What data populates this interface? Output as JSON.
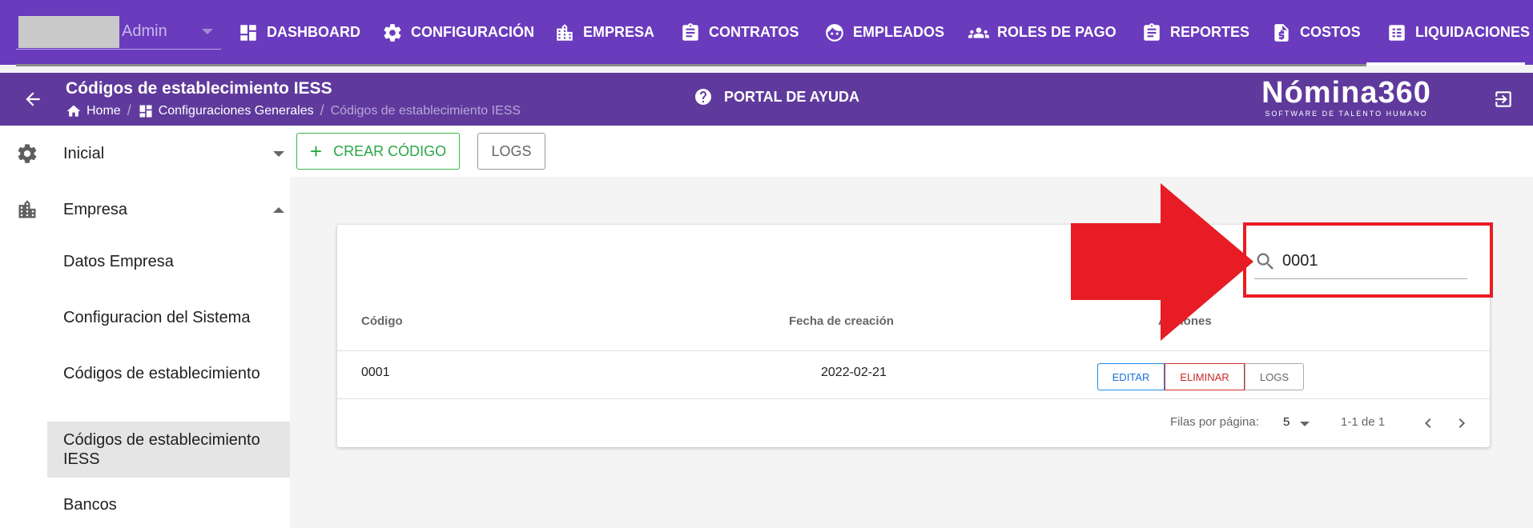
{
  "topbar": {
    "user_name": "Admin",
    "nav": [
      {
        "label": "DASHBOARD",
        "icon": "dashboard-icon"
      },
      {
        "label": "CONFIGURACIÓN",
        "icon": "gear-icon"
      },
      {
        "label": "EMPRESA",
        "icon": "building-icon"
      },
      {
        "label": "CONTRATOS",
        "icon": "clipboard-icon"
      },
      {
        "label": "EMPLEADOS",
        "icon": "face-icon"
      },
      {
        "label": "ROLES DE PAGO",
        "icon": "group-icon"
      },
      {
        "label": "REPORTES",
        "icon": "clipboard-icon"
      },
      {
        "label": "COSTOS",
        "icon": "invoice-icon"
      },
      {
        "label": "LIQUIDACIONES",
        "icon": "list-icon"
      }
    ]
  },
  "subheader": {
    "title": "Códigos de establecimiento IESS",
    "breadcrumb": {
      "home": "Home",
      "section": "Configuraciones Generales",
      "current": "Códigos de establecimiento IESS"
    },
    "help": "PORTAL DE AYUDA",
    "logo": {
      "main": "Nómina360",
      "sub": "SOFTWARE DE TALENTO HUMANO"
    }
  },
  "sidebar": {
    "groups": [
      {
        "label": "Inicial",
        "icon": "gear-icon",
        "expanded": false
      },
      {
        "label": "Empresa",
        "icon": "building-icon",
        "expanded": true
      }
    ],
    "items": [
      {
        "label": "Datos Empresa"
      },
      {
        "label": "Configuracion del Sistema"
      },
      {
        "label": "Códigos de establecimiento"
      },
      {
        "label": "Códigos de establecimiento IESS",
        "active": true
      },
      {
        "label": "Bancos"
      }
    ]
  },
  "toolbar": {
    "create_label": "CREAR CÓDIGO",
    "logs_label": "LOGS"
  },
  "table": {
    "search_value": "0001",
    "headers": {
      "codigo": "Código",
      "fecha": "Fecha de creación",
      "acciones": "Acciones"
    },
    "rows": [
      {
        "codigo": "0001",
        "fecha": "2022-02-21"
      }
    ],
    "actions": {
      "edit": "EDITAR",
      "delete": "ELIMINAR",
      "logs": "LOGS"
    },
    "footer": {
      "rows_per_page_label": "Filas por página:",
      "rows_per_page": "5",
      "range": "1-1 de 1"
    }
  },
  "colors": {
    "primary": "#6a3bbd",
    "subheader": "#5f3a9c",
    "annotation": "#e81c24",
    "success": "#28a745"
  }
}
